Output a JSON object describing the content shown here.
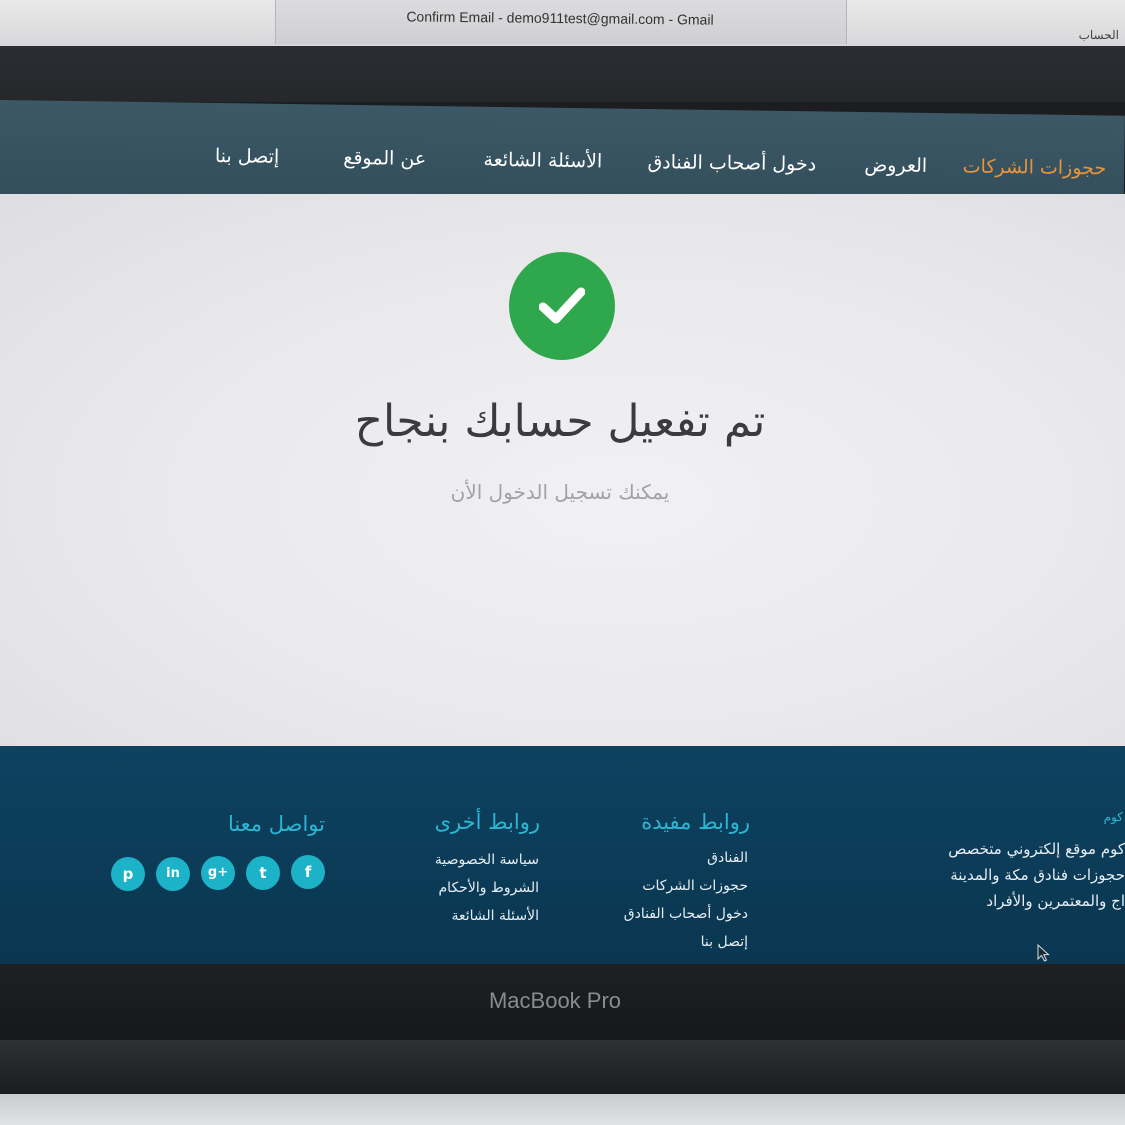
{
  "browser": {
    "window_title": "Confirm Email - demo911test@gmail.com - Gmail",
    "right_fragment": "الحساب"
  },
  "nav": {
    "items": [
      {
        "label": "حجوزات الشركات",
        "active": true
      },
      {
        "label": "العروض",
        "active": false
      },
      {
        "label": "دخول أصحاب الفنادق",
        "active": false
      },
      {
        "label": "الأسئلة الشائعة",
        "active": false
      },
      {
        "label": "عن الموقع",
        "active": false
      },
      {
        "label": "إتصل بنا",
        "active": false
      }
    ]
  },
  "main": {
    "success_icon": "check-circle-icon",
    "headline": "تم تفعيل حسابك بنجاح",
    "subline": "يمكنك تسجيل الدخول الأن"
  },
  "footer": {
    "about": {
      "title": "كوم",
      "lines": [
        "كوم موقع إلكتروني متخصص",
        "حجوزات فنادق مكة والمدينة",
        "اج والمعتمرين والأفراد"
      ]
    },
    "useful_links": {
      "title": "روابط مفيدة",
      "links": [
        "الفنادق",
        "حجوزات الشركات",
        "دخول أصحاب الفنادق",
        "إتصل بنا"
      ]
    },
    "other_links": {
      "title": "روابط أخرى",
      "links": [
        "سياسة الخصوصية",
        "الشروط والأحكام",
        "الأسئلة الشائعة"
      ]
    },
    "contact": {
      "title": "تواصل معنا",
      "social": [
        {
          "icon": "facebook-icon",
          "glyph": "f"
        },
        {
          "icon": "twitter-icon",
          "glyph": "t"
        },
        {
          "icon": "google-plus-icon",
          "glyph": "g+"
        },
        {
          "icon": "linkedin-icon",
          "glyph": "in"
        },
        {
          "icon": "pinterest-icon",
          "glyph": "p"
        }
      ]
    }
  },
  "device": {
    "brand": "MacBook Pro"
  },
  "colors": {
    "nav_bg": "#3c5866",
    "nav_active": "#e8943b",
    "success_green": "#2fa84d",
    "footer_bg": "#0d4260",
    "footer_title": "#2bb6d3",
    "social_bg": "#1cb3c8"
  }
}
